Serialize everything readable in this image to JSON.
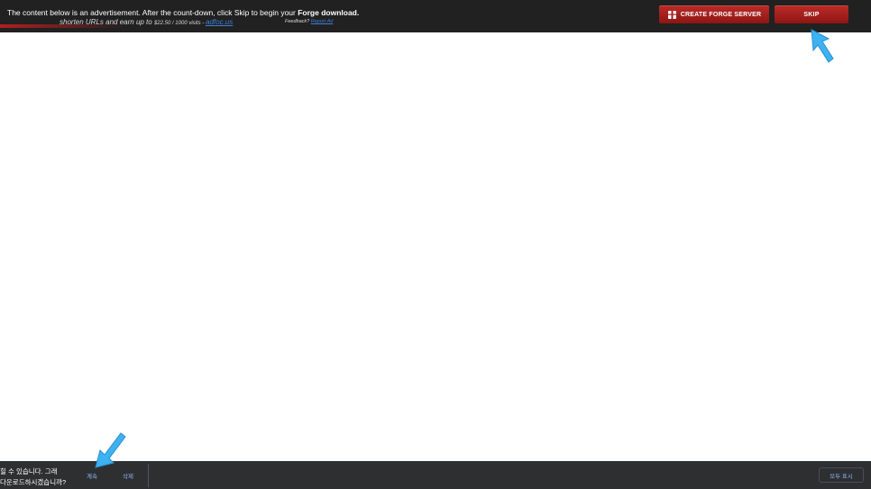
{
  "ad_bar": {
    "message_prefix": "The content below is an advertisement. After the count-down, click Skip to begin your ",
    "message_bold": "Forge download.",
    "promo_text": "shorten URLs and earn up to ",
    "promo_rate": "$22.50 / 1000 visits",
    "promo_sep": " - ",
    "promo_link": "adfoc.us",
    "feedback_label": "Feedback? ",
    "report_link": "Report Ad",
    "create_server_label": "CREATE FORGE SERVER",
    "skip_label": "SKIP",
    "colors": {
      "button_red": "#a11f1c",
      "bar_bg": "#212121",
      "link": "#3b7fd8"
    }
  },
  "download_bar": {
    "warning_line1": "힐 수 있습니다. 그래",
    "warning_line2": "다운로드하시겠습니까?",
    "continue_label": "계속",
    "delete_label": "삭제",
    "show_all_label": "모두 표시",
    "colors": {
      "bar_bg": "#2e2f31",
      "link": "#8ab4f8"
    }
  },
  "annotations": {
    "arrow_color": "#3db2f2",
    "icons": [
      "arrow-pointer-icon",
      "server-icon"
    ]
  }
}
